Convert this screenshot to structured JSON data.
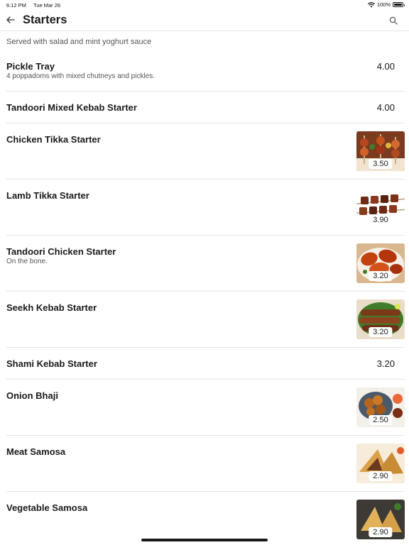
{
  "status_bar": {
    "time": "6:12 PM",
    "date": "Tue Mar 26",
    "battery": "100%"
  },
  "header": {
    "title": "Starters",
    "back_icon": "arrow-left-icon",
    "search_icon": "search-icon"
  },
  "section": {
    "subtitle": "Served with salad and mint yoghurt sauce"
  },
  "items": [
    {
      "name": "Pickle Tray",
      "description": "4 poppadoms with mixed chutneys and pickles.",
      "price": "4.00"
    },
    {
      "name": "Tandoori Mixed Kebab Starter",
      "price": "4.00"
    },
    {
      "name": "Chicken Tikka Starter",
      "price": "3.50",
      "image": "chicken-tikka-skewers-photo"
    },
    {
      "name": "Lamb Tikka Starter",
      "price": "3.90",
      "image": "lamb-tikka-skewers-photo"
    },
    {
      "name": "Tandoori Chicken Starter",
      "description": "On the bone.",
      "price": "3.20",
      "image": "tandoori-chicken-photo"
    },
    {
      "name": "Seekh Kebab Starter",
      "price": "3.20",
      "image": "seekh-kebab-photo"
    },
    {
      "name": "Shami Kebab Starter",
      "price": "3.20"
    },
    {
      "name": "Onion Bhaji",
      "price": "2.50",
      "image": "onion-bhaji-photo"
    },
    {
      "name": "Meat Samosa",
      "price": "2.90",
      "image": "meat-samosa-photo"
    },
    {
      "name": "Vegetable Samosa",
      "price": "2.90",
      "image": "vegetable-samosa-photo"
    }
  ],
  "colors": {
    "text": "#1a1a1a",
    "secondary_text": "#555555",
    "divider": "#e4e4e4",
    "background": "#ffffff"
  }
}
